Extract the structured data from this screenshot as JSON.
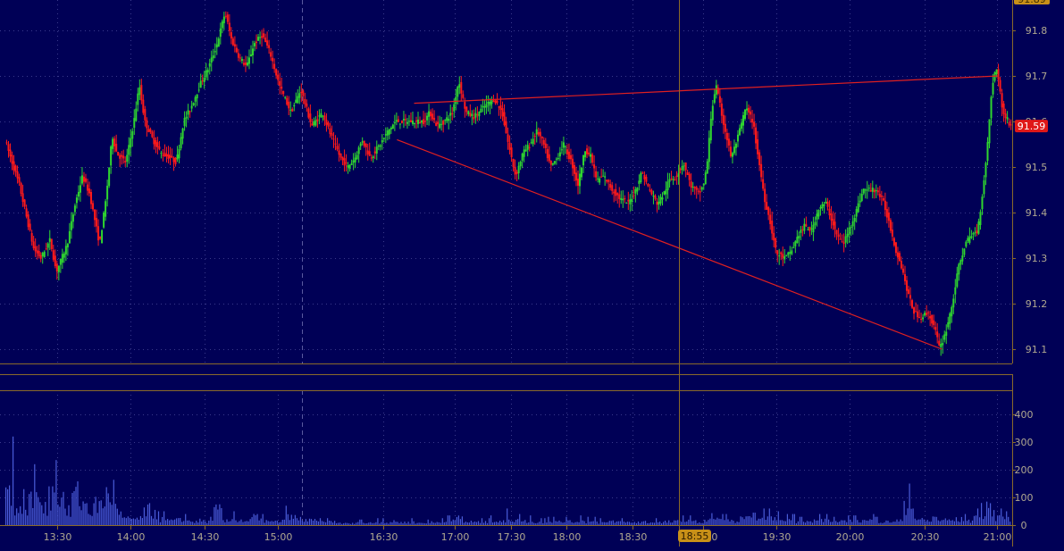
{
  "colors": {
    "background": "#000056",
    "grid": "#3a3a8c",
    "panel_border": "#8a6a2a",
    "axis_text": "#b0a890",
    "candle_up": "#2fd62f",
    "candle_down": "#ff1a1a",
    "trendline": "#e02020",
    "volume_bar": "#4a5cd8",
    "last_price_bg": "#e01818",
    "cursor_time_bg": "#c89018",
    "crosshair": "#8a6a2a"
  },
  "chart_data": {
    "type": "candlestick",
    "price_axis": {
      "ticks": [
        "91.1",
        "91.2",
        "91.3",
        "91.4",
        "91.5",
        "91.6",
        "91.7",
        "91.8"
      ],
      "range": [
        91.1,
        91.89
      ],
      "top_label": "91.89",
      "last_price_label": "91.59",
      "last_price": 91.59
    },
    "volume_axis": {
      "ticks": [
        "0",
        "100",
        "200",
        "300",
        "400"
      ],
      "range": [
        0,
        400
      ]
    },
    "time_axis": {
      "labels": [
        "13:30",
        "14:00",
        "14:30",
        "15:00",
        "16:30",
        "17:00",
        "17:30",
        "18:00",
        "18:30",
        "19:00",
        "19:30",
        "20:00",
        "20:30",
        "21:00"
      ],
      "cursor_label": "18:55"
    },
    "price_path": [
      [
        0,
        91.56
      ],
      [
        1.6,
        91.46
      ],
      [
        3.2,
        91.32
      ],
      [
        4.0,
        91.3
      ],
      [
        5.0,
        91.34
      ],
      [
        5.7,
        91.27
      ],
      [
        6.9,
        91.33
      ],
      [
        7.8,
        91.42
      ],
      [
        8.6,
        91.48
      ],
      [
        9.4,
        91.44
      ],
      [
        10.5,
        91.33
      ],
      [
        11.2,
        91.43
      ],
      [
        11.9,
        91.57
      ],
      [
        12.4,
        91.53
      ],
      [
        13.4,
        91.51
      ],
      [
        14.3,
        91.6
      ],
      [
        14.9,
        91.68
      ],
      [
        15.5,
        91.6
      ],
      [
        16.4,
        91.56
      ],
      [
        17.3,
        91.53
      ],
      [
        18.4,
        91.52
      ],
      [
        19.0,
        91.51
      ],
      [
        19.8,
        91.6
      ],
      [
        20.6,
        91.63
      ],
      [
        21.6,
        91.68
      ],
      [
        22.6,
        91.72
      ],
      [
        23.5,
        91.77
      ],
      [
        24.4,
        91.84
      ],
      [
        25.1,
        91.78
      ],
      [
        26.0,
        91.74
      ],
      [
        26.8,
        91.72
      ],
      [
        27.6,
        91.77
      ],
      [
        28.5,
        91.79
      ],
      [
        29.4,
        91.75
      ],
      [
        30.4,
        91.68
      ],
      [
        31.7,
        91.62
      ],
      [
        32.8,
        91.67
      ],
      [
        34.0,
        91.59
      ],
      [
        35.2,
        91.62
      ],
      [
        36.1,
        91.57
      ],
      [
        37.2,
        91.52
      ],
      [
        38.0,
        91.5
      ],
      [
        38.8,
        91.52
      ],
      [
        39.6,
        91.56
      ],
      [
        40.5,
        91.52
      ],
      [
        41.6,
        91.55
      ],
      [
        42.5,
        91.58
      ],
      [
        43.3,
        91.6
      ],
      [
        44.4,
        91.6
      ],
      [
        45.3,
        91.6
      ],
      [
        46.4,
        91.6
      ],
      [
        47.1,
        91.62
      ],
      [
        47.9,
        91.59
      ],
      [
        48.7,
        91.6
      ],
      [
        49.6,
        91.62
      ],
      [
        50.3,
        91.69
      ],
      [
        51.1,
        91.62
      ],
      [
        52.0,
        91.61
      ],
      [
        53.0,
        91.63
      ],
      [
        54.2,
        91.65
      ],
      [
        55.1,
        91.62
      ],
      [
        55.8,
        91.55
      ],
      [
        56.6,
        91.48
      ],
      [
        57.4,
        91.53
      ],
      [
        58.2,
        91.55
      ],
      [
        59.0,
        91.58
      ],
      [
        59.7,
        91.55
      ],
      [
        60.5,
        91.5
      ],
      [
        61.2,
        91.52
      ],
      [
        61.9,
        91.55
      ],
      [
        62.8,
        91.51
      ],
      [
        63.5,
        91.46
      ],
      [
        64.3,
        91.54
      ],
      [
        65.0,
        91.52
      ],
      [
        65.6,
        91.47
      ],
      [
        66.4,
        91.48
      ],
      [
        67.3,
        91.45
      ],
      [
        68.2,
        91.43
      ],
      [
        69.1,
        91.42
      ],
      [
        69.9,
        91.45
      ],
      [
        70.6,
        91.49
      ],
      [
        71.4,
        91.45
      ],
      [
        72.3,
        91.42
      ],
      [
        73.0,
        91.44
      ],
      [
        73.6,
        91.47
      ],
      [
        74.4,
        91.48
      ],
      [
        75.2,
        91.51
      ],
      [
        76.0,
        91.46
      ],
      [
        76.9,
        91.44
      ],
      [
        77.4,
        91.46
      ],
      [
        77.8,
        91.5
      ],
      [
        78.3,
        91.62
      ],
      [
        78.8,
        91.68
      ],
      [
        79.6,
        91.6
      ],
      [
        80.5,
        91.52
      ],
      [
        81.3,
        91.57
      ],
      [
        82.1,
        91.63
      ],
      [
        82.9,
        91.6
      ],
      [
        83.5,
        91.52
      ],
      [
        84.2,
        91.43
      ],
      [
        84.8,
        91.38
      ],
      [
        85.5,
        91.31
      ],
      [
        86.5,
        91.3
      ],
      [
        87.3,
        91.32
      ],
      [
        87.9,
        91.35
      ],
      [
        88.6,
        91.37
      ],
      [
        89.4,
        91.36
      ],
      [
        90.2,
        91.41
      ],
      [
        91.0,
        91.42
      ],
      [
        91.7,
        91.38
      ],
      [
        92.2,
        91.35
      ],
      [
        92.9,
        91.33
      ],
      [
        93.5,
        91.36
      ],
      [
        94.3,
        91.4
      ],
      [
        95.1,
        91.45
      ],
      [
        96.0,
        91.45
      ],
      [
        96.6,
        91.45
      ],
      [
        97.4,
        91.42
      ],
      [
        98.1,
        91.37
      ],
      [
        98.7,
        91.32
      ],
      [
        99.4,
        91.28
      ],
      [
        100.1,
        91.22
      ],
      [
        100.8,
        91.18
      ],
      [
        101.5,
        91.17
      ],
      [
        102.3,
        91.18
      ],
      [
        103.0,
        91.15
      ],
      [
        103.6,
        91.1
      ],
      [
        104.3,
        91.14
      ],
      [
        105.0,
        91.2
      ],
      [
        105.7,
        91.28
      ],
      [
        106.4,
        91.33
      ],
      [
        107.1,
        91.35
      ],
      [
        107.8,
        91.36
      ],
      [
        108.4,
        91.45
      ],
      [
        108.9,
        91.55
      ],
      [
        109.4,
        91.68
      ],
      [
        109.9,
        91.72
      ],
      [
        110.6,
        91.62
      ],
      [
        111.5,
        91.59
      ]
    ],
    "volume_levels": [
      [
        0,
        320
      ],
      [
        1.6,
        130
      ],
      [
        3.2,
        220
      ],
      [
        5.0,
        140
      ],
      [
        5.7,
        235
      ],
      [
        6.9,
        120
      ],
      [
        7.8,
        280
      ],
      [
        8.6,
        200
      ],
      [
        9.4,
        145
      ],
      [
        10.5,
        190
      ],
      [
        11.2,
        270
      ],
      [
        11.9,
        320
      ],
      [
        12.4,
        110
      ],
      [
        13.4,
        55
      ],
      [
        14.3,
        60
      ],
      [
        14.9,
        55
      ],
      [
        15.5,
        140
      ],
      [
        16.4,
        55
      ],
      [
        17.3,
        50
      ],
      [
        18.4,
        40
      ],
      [
        19.0,
        45
      ],
      [
        19.8,
        40
      ],
      [
        20.6,
        35
      ],
      [
        21.6,
        40
      ],
      [
        22.6,
        30
      ],
      [
        23.5,
        130
      ],
      [
        24.4,
        35
      ],
      [
        25.1,
        50
      ],
      [
        26.0,
        45
      ],
      [
        26.8,
        40
      ],
      [
        27.6,
        75
      ],
      [
        28.5,
        40
      ],
      [
        29.4,
        30
      ],
      [
        30.4,
        35
      ],
      [
        31.7,
        70
      ],
      [
        32.8,
        55
      ],
      [
        34.0,
        40
      ],
      [
        35.2,
        25
      ],
      [
        36.1,
        30
      ],
      [
        37.2,
        20
      ],
      [
        38.0,
        15
      ],
      [
        39.6,
        20
      ],
      [
        41.6,
        25
      ],
      [
        43.3,
        30
      ],
      [
        44.4,
        25
      ],
      [
        46.4,
        20
      ],
      [
        47.9,
        25
      ],
      [
        49.6,
        35
      ],
      [
        50.3,
        70
      ],
      [
        51.1,
        30
      ],
      [
        53.0,
        25
      ],
      [
        54.2,
        35
      ],
      [
        55.1,
        30
      ],
      [
        55.8,
        60
      ],
      [
        56.6,
        40
      ],
      [
        57.4,
        35
      ],
      [
        59.0,
        25
      ],
      [
        60.5,
        30
      ],
      [
        61.9,
        30
      ],
      [
        63.5,
        35
      ],
      [
        65.0,
        30
      ],
      [
        66.4,
        25
      ],
      [
        67.3,
        30
      ],
      [
        69.1,
        25
      ],
      [
        70.6,
        30
      ],
      [
        72.3,
        25
      ],
      [
        73.6,
        30
      ],
      [
        75.2,
        35
      ],
      [
        76.9,
        30
      ],
      [
        77.8,
        45
      ],
      [
        78.3,
        80
      ],
      [
        78.8,
        60
      ],
      [
        79.6,
        40
      ],
      [
        80.5,
        35
      ],
      [
        82.1,
        55
      ],
      [
        83.5,
        45
      ],
      [
        84.2,
        60
      ],
      [
        85.5,
        50
      ],
      [
        86.5,
        40
      ],
      [
        88.6,
        30
      ],
      [
        90.2,
        40
      ],
      [
        92.2,
        30
      ],
      [
        94.3,
        35
      ],
      [
        95.1,
        40
      ],
      [
        97.4,
        30
      ],
      [
        98.7,
        40
      ],
      [
        100.1,
        150
      ],
      [
        100.8,
        60
      ],
      [
        101.5,
        45
      ],
      [
        102.3,
        40
      ],
      [
        103.0,
        70
      ],
      [
        103.6,
        50
      ],
      [
        104.3,
        45
      ],
      [
        105.7,
        50
      ],
      [
        106.4,
        40
      ],
      [
        107.8,
        60
      ],
      [
        108.4,
        80
      ],
      [
        108.9,
        180
      ],
      [
        109.4,
        120
      ],
      [
        109.9,
        60
      ],
      [
        111.5,
        50
      ]
    ],
    "trendlines": [
      {
        "from": [
          45.3,
          91.64
        ],
        "to": [
          110.1,
          91.7
        ]
      },
      {
        "from": [
          43.4,
          91.56
        ],
        "to": [
          103.8,
          91.1
        ]
      }
    ],
    "cursor_time": 18.55
  }
}
